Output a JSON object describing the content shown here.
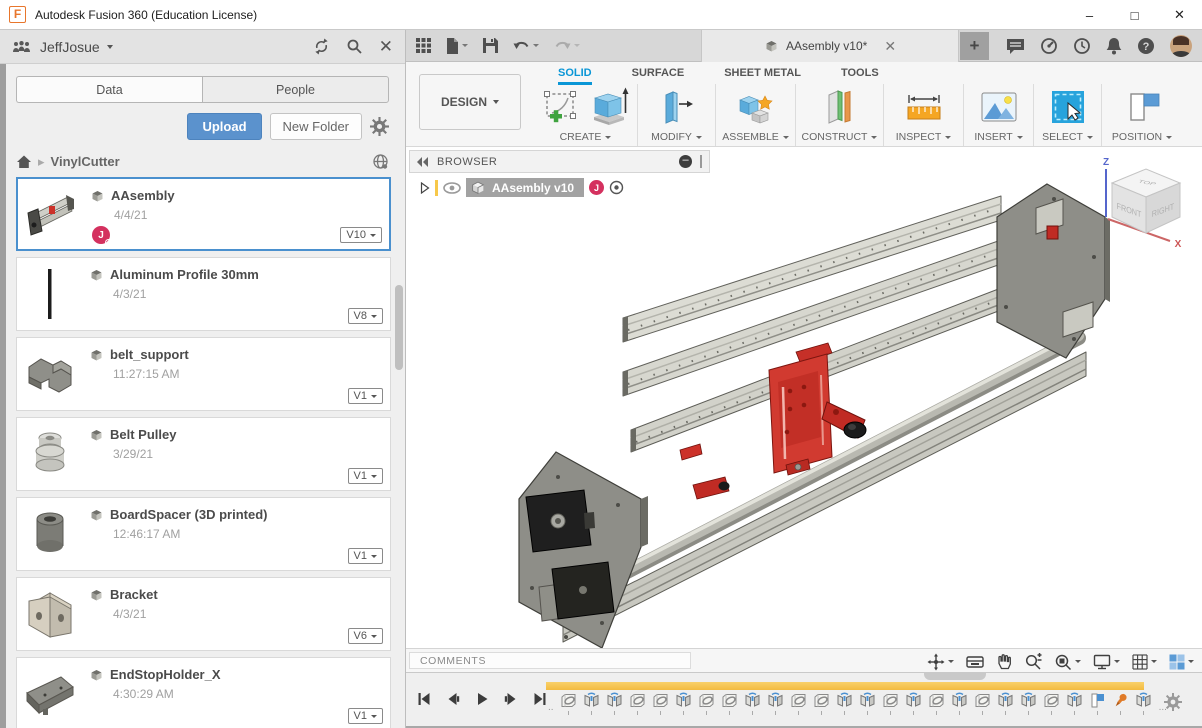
{
  "titlebar": {
    "title": "Autodesk Fusion 360 (Education License)"
  },
  "data_panel": {
    "user": "JeffJosue",
    "tabs": [
      {
        "label": "Data",
        "active": true
      },
      {
        "label": "People",
        "active": false
      }
    ],
    "actions": {
      "upload": "Upload",
      "new_folder": "New Folder"
    },
    "breadcrumb": {
      "folder": "VinylCutter"
    },
    "items": [
      {
        "name": "AAsembly",
        "date": "4/4/21",
        "version": "V10",
        "thumb": "assembly",
        "selected": true,
        "badge": "J"
      },
      {
        "name": "Aluminum Profile 30mm",
        "date": "4/3/21",
        "version": "V8",
        "thumb": "profile",
        "selected": false
      },
      {
        "name": "belt_support",
        "date": "11:27:15 AM",
        "version": "V1",
        "thumb": "belt_support",
        "selected": false
      },
      {
        "name": "Belt Pulley",
        "date": "3/29/21",
        "version": "V1",
        "thumb": "pulley",
        "selected": false
      },
      {
        "name": "BoardSpacer (3D printed)",
        "date": "12:46:17 AM",
        "version": "V1",
        "thumb": "spacer",
        "selected": false
      },
      {
        "name": "Bracket",
        "date": "4/3/21",
        "version": "V6",
        "thumb": "bracket",
        "selected": false
      },
      {
        "name": "EndStopHolder_X",
        "date": "4:30:29 AM",
        "version": "V1",
        "thumb": "endstop",
        "selected": false
      }
    ]
  },
  "toolbar": {
    "document_tab": {
      "title": "AAsembly v10*"
    },
    "workspace": "DESIGN",
    "tabs": [
      "SOLID",
      "SURFACE",
      "SHEET METAL",
      "TOOLS"
    ],
    "active_tab": "SOLID",
    "groups": [
      {
        "label": "CREATE"
      },
      {
        "label": "MODIFY"
      },
      {
        "label": "ASSEMBLE"
      },
      {
        "label": "CONSTRUCT"
      },
      {
        "label": "INSPECT"
      },
      {
        "label": "INSERT"
      },
      {
        "label": "SELECT"
      },
      {
        "label": "POSITION"
      }
    ]
  },
  "browser": {
    "title": "BROWSER",
    "root_node": {
      "name": "AAsembly v10",
      "badge": "J"
    }
  },
  "viewcube": {
    "top": "TOP",
    "front": "FRONT",
    "right": "RIGHT",
    "axis_z": "Z",
    "axis_x": "X"
  },
  "viewport_toolbar": {
    "comments": "COMMENTS",
    "icons": [
      "orbit",
      "look-at",
      "pan",
      "zoom",
      "fit",
      "display-settings",
      "grid-display",
      "viewports"
    ]
  },
  "timeline": {
    "playback": [
      "go-to-start",
      "step-back",
      "play",
      "step-forward",
      "go-to-end"
    ],
    "features": [
      "link",
      "joint",
      "joint",
      "link",
      "link",
      "joint",
      "link",
      "link",
      "joint",
      "joint",
      "link",
      "link",
      "joint",
      "joint",
      "link",
      "joint",
      "link",
      "joint",
      "link",
      "joint",
      "joint",
      "link",
      "joint"
    ],
    "markers": [
      "flag",
      "pin",
      "joint"
    ]
  },
  "colors": {
    "accent_blue": "#0a96d6",
    "selection_blue": "#4a90ce",
    "upload_blue": "#5b92cd",
    "badge_pink": "#d4315f",
    "timeline_yellow": "#f7c64e",
    "red_part": "#cc3129"
  }
}
